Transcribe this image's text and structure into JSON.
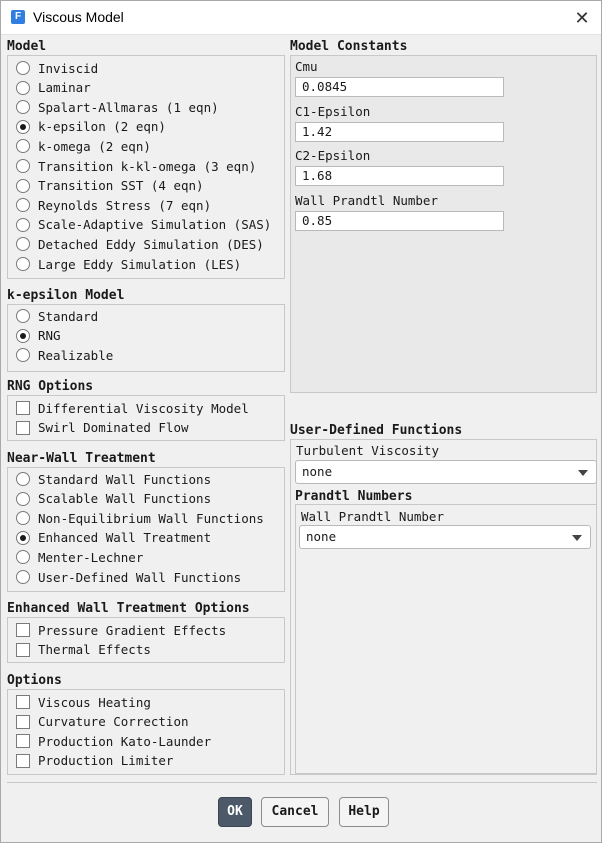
{
  "window": {
    "title": "Viscous Model",
    "app_icon_letter": "F"
  },
  "model": {
    "title": "Model",
    "options": [
      "Inviscid",
      "Laminar",
      "Spalart-Allmaras (1 eqn)",
      "k-epsilon (2 eqn)",
      "k-omega (2 eqn)",
      "Transition k-kl-omega (3 eqn)",
      "Transition SST (4 eqn)",
      "Reynolds Stress (7 eqn)",
      "Scale-Adaptive Simulation (SAS)",
      "Detached Eddy Simulation (DES)",
      "Large Eddy Simulation (LES)"
    ],
    "selected": "k-epsilon (2 eqn)"
  },
  "ke_model": {
    "title": "k-epsilon Model",
    "options": [
      "Standard",
      "RNG",
      "Realizable"
    ],
    "selected": "RNG"
  },
  "rng_options": {
    "title": "RNG Options",
    "items": [
      "Differential Viscosity Model",
      "Swirl Dominated Flow"
    ]
  },
  "near_wall": {
    "title": "Near-Wall Treatment",
    "options": [
      "Standard Wall Functions",
      "Scalable Wall Functions",
      "Non-Equilibrium Wall Functions",
      "Enhanced Wall Treatment",
      "Menter-Lechner",
      "User-Defined Wall Functions"
    ],
    "selected": "Enhanced Wall Treatment"
  },
  "ewt_options": {
    "title": "Enhanced Wall Treatment Options",
    "items": [
      "Pressure Gradient Effects",
      "Thermal Effects"
    ]
  },
  "options": {
    "title": "Options",
    "items": [
      "Viscous Heating",
      "Curvature Correction",
      "Production Kato-Launder",
      "Production Limiter"
    ]
  },
  "constants": {
    "title": "Model Constants",
    "items": [
      {
        "label": "Cmu",
        "value": "0.0845"
      },
      {
        "label": "C1-Epsilon",
        "value": "1.42"
      },
      {
        "label": "C2-Epsilon",
        "value": "1.68"
      },
      {
        "label": "Wall Prandtl Number",
        "value": "0.85"
      }
    ]
  },
  "udf": {
    "title": "User-Defined Functions",
    "turbulent_viscosity_label": "Turbulent Viscosity",
    "turbulent_viscosity_value": "none",
    "prandtl_title": "Prandtl Numbers",
    "wall_prandtl_label": "Wall Prandtl Number",
    "wall_prandtl_value": "none"
  },
  "buttons": {
    "ok": "OK",
    "cancel": "Cancel",
    "help": "Help"
  }
}
